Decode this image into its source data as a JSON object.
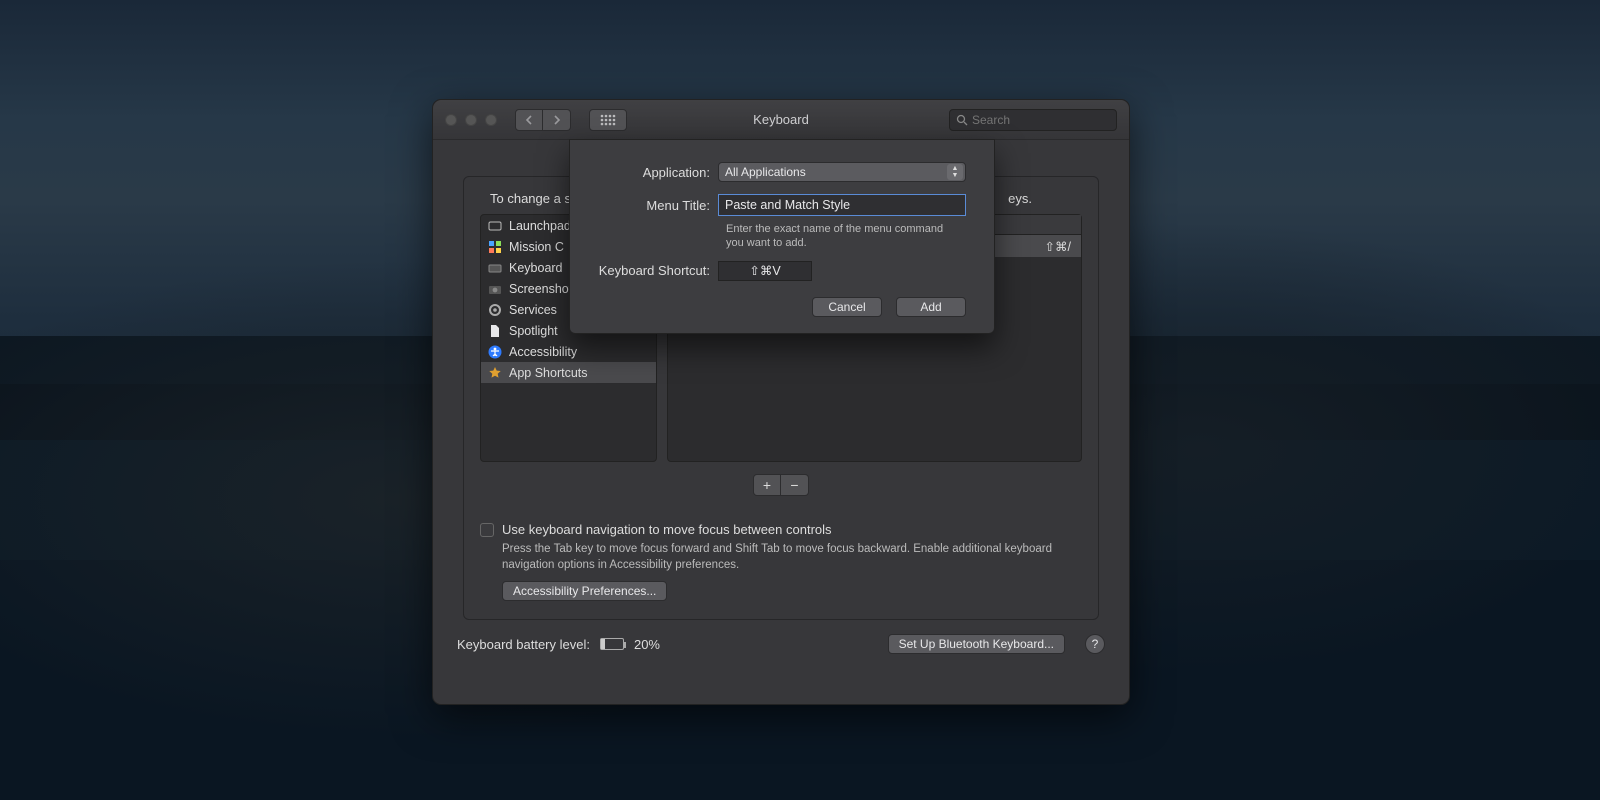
{
  "window": {
    "title": "Keyboard",
    "search_placeholder": "Search"
  },
  "panel": {
    "instruction_visible": "To change a sh",
    "instruction_trailer": "eys.",
    "categories": [
      {
        "label": "Launchpad",
        "icon": "rocket",
        "color": "#6e6e70"
      },
      {
        "label": "Mission C",
        "icon": "grid4",
        "color": "#4aa3ff"
      },
      {
        "label": "Keyboard",
        "icon": "keyboard",
        "color": "#6e6e70"
      },
      {
        "label": "Screenshot",
        "icon": "camera",
        "color": "#6e6e70"
      },
      {
        "label": "Services",
        "icon": "gear",
        "color": "#6e6e70"
      },
      {
        "label": "Spotlight",
        "icon": "doc",
        "color": "#e8e8ea"
      },
      {
        "label": "Accessibility",
        "icon": "access",
        "color": "#2e7bff"
      },
      {
        "label": "App Shortcuts",
        "icon": "star",
        "color": "#e0a030"
      }
    ],
    "selected_category_index": 7,
    "right": {
      "rows": [
        {
          "text": "",
          "shortcut": "⇧⌘/"
        }
      ]
    }
  },
  "kb_nav": {
    "checkbox_label": "Use keyboard navigation to move focus between controls",
    "hint": "Press the Tab key to move focus forward and Shift Tab to move focus backward. Enable additional keyboard navigation options in Accessibility preferences.",
    "button_label": "Accessibility Preferences..."
  },
  "footer": {
    "battery_label": "Keyboard battery level:",
    "battery_pct": "20%",
    "bt_button": "Set Up Bluetooth Keyboard...",
    "help": "?"
  },
  "sheet": {
    "app_label": "Application:",
    "app_value": "All Applications",
    "menu_label": "Menu Title:",
    "menu_value": "Paste and Match Style",
    "menu_hint": "Enter the exact name of the menu command you want to add.",
    "sc_label": "Keyboard Shortcut:",
    "sc_value": "⇧⌘V",
    "cancel": "Cancel",
    "add": "Add"
  }
}
